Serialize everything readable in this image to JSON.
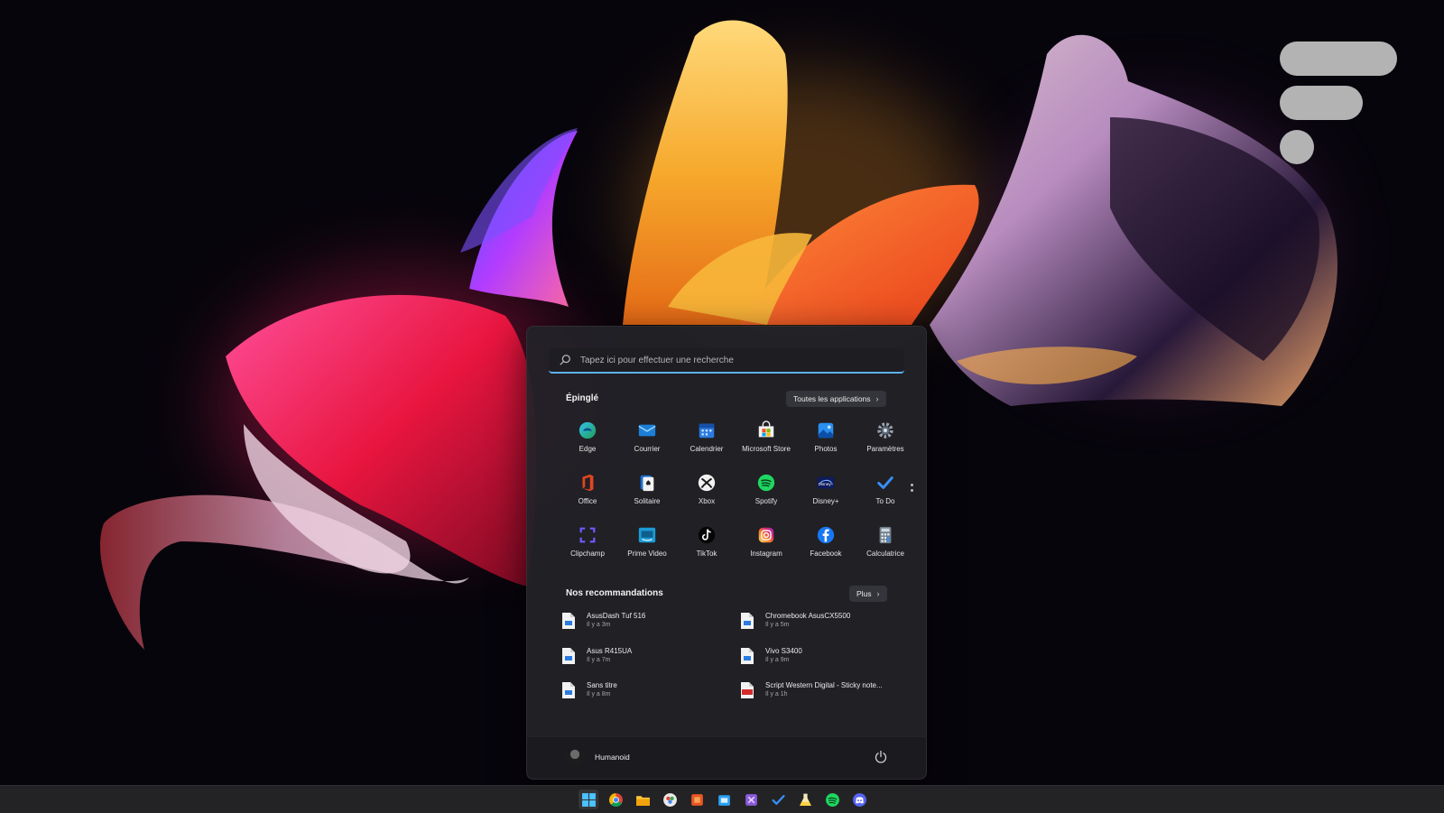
{
  "search": {
    "placeholder": "Tapez ici pour effectuer une recherche"
  },
  "pinned": {
    "title": "Épinglé",
    "all_apps_label": "Toutes les applications",
    "apps": [
      {
        "label": "Edge",
        "icon": "edge-icon"
      },
      {
        "label": "Courrier",
        "icon": "mail-icon"
      },
      {
        "label": "Calendrier",
        "icon": "calendar-icon"
      },
      {
        "label": "Microsoft Store",
        "icon": "store-icon"
      },
      {
        "label": "Photos",
        "icon": "photos-icon"
      },
      {
        "label": "Paramètres",
        "icon": "gear-icon"
      },
      {
        "label": "Office",
        "icon": "office-icon"
      },
      {
        "label": "Solitaire",
        "icon": "solitaire-icon"
      },
      {
        "label": "Xbox",
        "icon": "xbox-icon"
      },
      {
        "label": "Spotify",
        "icon": "spotify-icon"
      },
      {
        "label": "Disney+",
        "icon": "disney-plus-icon"
      },
      {
        "label": "To Do",
        "icon": "todo-check-icon"
      },
      {
        "label": "Clipchamp",
        "icon": "clipchamp-icon"
      },
      {
        "label": "Prime Video",
        "icon": "prime-video-icon"
      },
      {
        "label": "TikTok",
        "icon": "tiktok-icon"
      },
      {
        "label": "Instagram",
        "icon": "instagram-icon"
      },
      {
        "label": "Facebook",
        "icon": "facebook-icon"
      },
      {
        "label": "Calculatrice",
        "icon": "calculator-icon"
      }
    ]
  },
  "recommended": {
    "title": "Nos recommandations",
    "more_label": "Plus",
    "items": [
      {
        "name": "AsusDash Tuf 516",
        "time": "Il y a 3m",
        "icon": "document-icon"
      },
      {
        "name": "Chromebook AsusCX5500",
        "time": "Il y a 5m",
        "icon": "document-icon"
      },
      {
        "name": "Asus R415UA",
        "time": "Il y a 7m",
        "icon": "document-icon"
      },
      {
        "name": "Vivo S3400",
        "time": "Il y a 9m",
        "icon": "document-icon"
      },
      {
        "name": "Sans titre",
        "time": "Il y a 8m",
        "icon": "document-icon"
      },
      {
        "name": "Script Western Digital - Sticky note...",
        "time": "Il y a 1h",
        "icon": "pdf-icon"
      }
    ]
  },
  "user": {
    "name": "Humanoid"
  },
  "taskbar": {
    "icons": [
      "windows-start-icon",
      "chrome-icon",
      "file-explorer-icon",
      "photos-app-icon",
      "office-app-icon",
      "store-app-icon",
      "visual-studio-icon",
      "todo-app-icon",
      "flask-icon",
      "spotify-app-icon",
      "discord-icon"
    ]
  },
  "colors": {
    "accent": "#5fb2f2",
    "menu_bg": "#222228",
    "taskbar_bg": "#232326"
  }
}
